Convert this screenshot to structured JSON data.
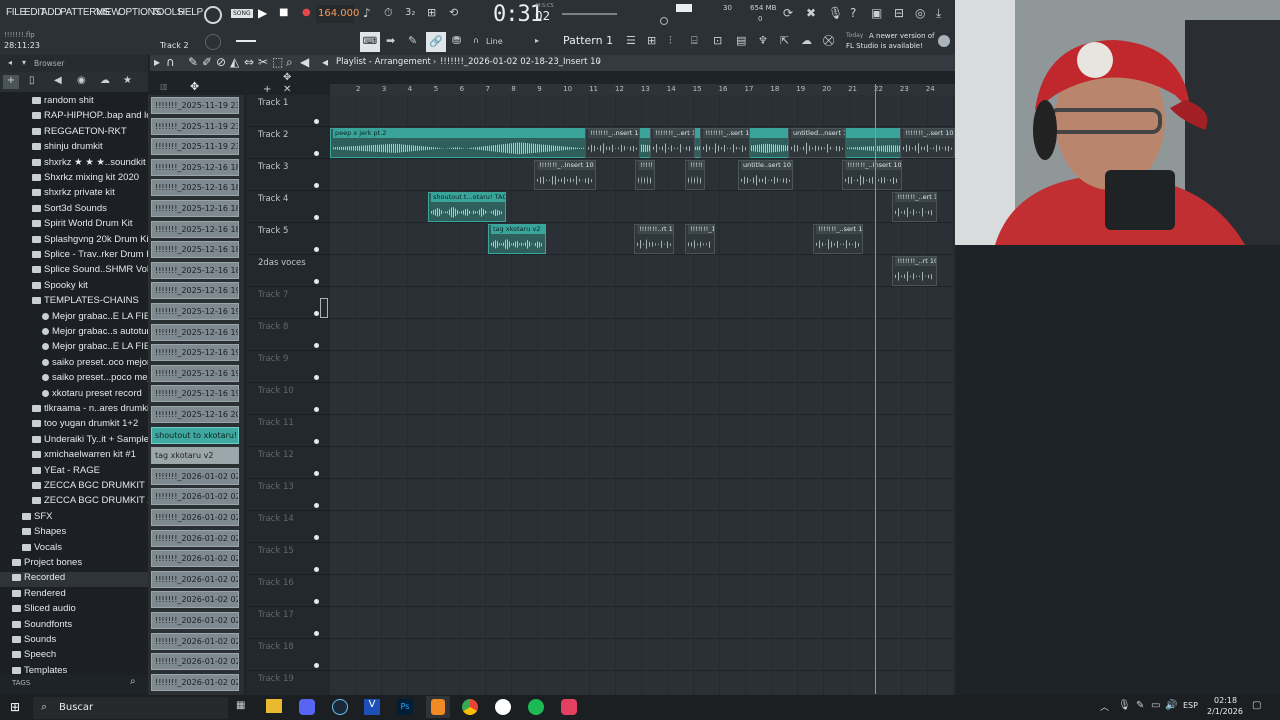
{
  "menu": [
    "FILE",
    "EDIT",
    "ADD",
    "PATTERNS",
    "VIEW",
    "OPTIONS",
    "TOOLS",
    "HELP"
  ],
  "transport": {
    "mode": "SONG",
    "bpm": "164.000",
    "time": "0:31",
    "time_frac": "02",
    "time_label": "M:S:CS"
  },
  "perf": {
    "cpu": "30",
    "mem": "654 MB",
    "voices": "0"
  },
  "project": {
    "file": "!!!!!!!.flp",
    "position": "28:11:23",
    "hint": "Track 2"
  },
  "pattern": "Pattern 1",
  "snap": "Line",
  "news": {
    "day": "Today",
    "line1": "A newer version of",
    "line2": "FL Studio is available!"
  },
  "playlist": {
    "title": "Playlist - Arrangement",
    "path": "!!!!!!!_2026-01-02 02-18-23_Insert 10"
  },
  "browser": {
    "title": "Browser",
    "items": [
      "random shit",
      "RAP-HIPHOP..bap and lofi",
      "REGGAETON-RKT",
      "shinju drumkit",
      "shxrkz ★ ★ ★..soundkit",
      "Shxrkz mixing kit 2020",
      "shxrkz private kit",
      "Sort3d Sounds",
      "Spirit World Drum Kit",
      "Splashgvng 20k Drum Kit",
      "Splice - Trav..rker Drum Kit",
      "Splice Sound..SHMR Vol. 3",
      "Spooky kit",
      "TEMPLATES-CHAINS",
      "Mejor grabac..E LA FIESTA",
      "Mejor grabac..s autotune)",
      "Mejor grabac..E LA FIESTA",
      "saiko preset..oco mejor v2",
      "saiko preset...poco mejor",
      "xkotaru preset record",
      "tlkraama - n..ares drumkit",
      "too yugan drumkit 1+2",
      "Underaiki Ty..it + Samples",
      "xmichaelwarren kit #1",
      "YEat - RAGE",
      "ZECCA BGC DRUMKIT",
      "ZECCA BGC DRUMKIT 2",
      "SFX",
      "Shapes",
      "Vocals",
      "Project bones",
      "Recorded",
      "Rendered",
      "Sliced audio",
      "Soundfonts",
      "Sounds",
      "Speech",
      "Templates"
    ],
    "tags_label": "TAGS"
  },
  "clips_list": [
    "!!!!!!!_2025-11-19 23-45...",
    "!!!!!!!_2025-11-19 23-47...",
    "!!!!!!!_2025-11-19 23-50...",
    "!!!!!!!_2025-12-16 18-36...",
    "!!!!!!!_2025-12-16 18-38...",
    "!!!!!!!_2025-12-16 18-42...",
    "!!!!!!!_2025-12-16 18-45...",
    "!!!!!!!_2025-12-16 18-48...",
    "!!!!!!!_2025-12-16 18-59...",
    "!!!!!!!_2025-12-16 19-00...",
    "!!!!!!!_2025-12-16 19-02...",
    "!!!!!!!_2025-12-16 19-04...",
    "!!!!!!!_2025-12-16 19-06...",
    "!!!!!!!_2025-12-16 19-07...",
    "!!!!!!!_2025-12-16 19-08...",
    "!!!!!!!_2025-12-16 20-18...",
    "shoutout to xkotaru!...",
    "tag xkotaru v2",
    "!!!!!!!_2026-01-02 02-13...",
    "!!!!!!!_2026-01-02 02-14...",
    "!!!!!!!_2026-01-02 02-15...",
    "!!!!!!!_2026-01-02 02-16...",
    "!!!!!!!_2026-01-02 02-17...",
    "!!!!!!!_2026-01-02 02-17...",
    "!!!!!!!_2026-01-02 02-17...",
    "!!!!!!!_2026-01-02 02-17...",
    "!!!!!!!_2026-01-02 02-18...",
    "!!!!!!!_2026-01-02 02-18...",
    "!!!!!!!_2026-01-02 02-18..."
  ],
  "tracks": [
    "Track 1",
    "Track 2",
    "Track 3",
    "Track 4",
    "Track 5",
    "2das voces",
    "Track 7",
    "Track 8",
    "Track 9",
    "Track 10",
    "Track 11",
    "Track 12",
    "Track 13",
    "Track 14",
    "Track 15",
    "Track 16",
    "Track 17",
    "Track 18",
    "Track 19"
  ],
  "ruler": [
    "2",
    "3",
    "4",
    "5",
    "6",
    "7",
    "8",
    "9",
    "10",
    "11",
    "12",
    "13",
    "14",
    "15",
    "16",
    "17",
    "18",
    "19",
    "20",
    "21",
    "22",
    "23",
    "24"
  ],
  "arr_clips": [
    "peep x jerk pt.2",
    "!!!!!!!_..nsert 10",
    "!!!!!!!_..ert 10",
    "!!!!!!!_..sert 10",
    "untitled...nsert 10",
    "!!!!!!!_..sert 10",
    "!!!!!!!_..Insert 10",
    "!!!!!!!_",
    "!!!!!!!_",
    "untitle..sert 10",
    "!!!!!!!_..Insert 10",
    "shoutout t...otaru! TAG",
    "!!!!!!!..rt 10",
    "tag xkotaru v2",
    "!!!!!!!_..rt 10",
    "!!!!!!!_10",
    "!!!!!!!_..sert 10",
    "!!!!!!!_..ert 10"
  ],
  "taskbar": {
    "search": "Buscar",
    "lang": "ESP",
    "time": "02:18",
    "date": "2/1/2026"
  }
}
